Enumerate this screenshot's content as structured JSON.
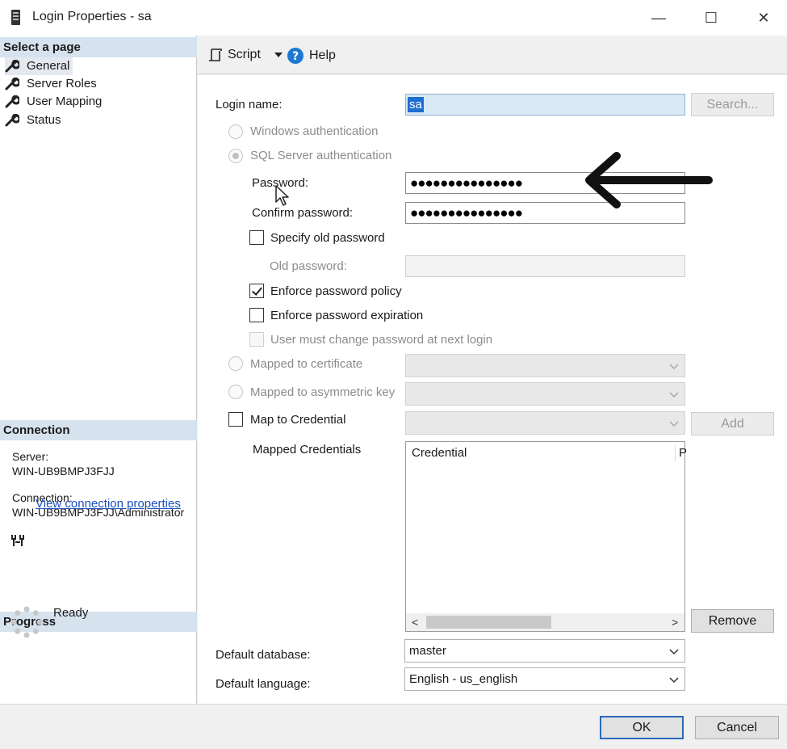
{
  "window": {
    "title": "Login Properties - sa",
    "minimize_glyph": "—",
    "maximize_glyph": "☐",
    "close_glyph": "✕"
  },
  "left_pane": {
    "select_page_header": "Select a page",
    "pages": [
      {
        "label": "General",
        "icon": "wrench-icon",
        "selected": true
      },
      {
        "label": "Server Roles",
        "icon": "wrench-icon",
        "selected": false
      },
      {
        "label": "User Mapping",
        "icon": "wrench-icon",
        "selected": false
      },
      {
        "label": "Status",
        "icon": "wrench-icon",
        "selected": false
      }
    ],
    "connection": {
      "header": "Connection",
      "server_label": "Server:",
      "server_value": "WIN-UB9BMPJ3FJJ",
      "connection_label": "Connection:",
      "connection_value": "WIN-UB9BMPJ3FJJ\\Administrator",
      "view_link": "View connection properties"
    },
    "progress": {
      "header": "Progress",
      "status": "Ready"
    }
  },
  "toolbar": {
    "script_label": "Script",
    "help_label": "Help"
  },
  "general": {
    "login_name_label": "Login name:",
    "login_name_value": "sa",
    "search_button": "Search...",
    "windows_auth_label": "Windows authentication",
    "sql_auth_label": "SQL Server authentication",
    "password_label": "Password:",
    "password_mask": "●●●●●●●●●●●●●●●",
    "confirm_password_label": "Confirm password:",
    "confirm_password_mask": "●●●●●●●●●●●●●●●",
    "specify_old_password_label": "Specify old password",
    "old_password_label": "Old password:",
    "enforce_policy_label": "Enforce password policy",
    "enforce_policy_checked": true,
    "enforce_expiration_label": "Enforce password expiration",
    "must_change_label": "User must change password at next login",
    "mapped_certificate_label": "Mapped to certificate",
    "mapped_asym_key_label": "Mapped to asymmetric key",
    "map_credential_label": "Map to Credential",
    "add_button": "Add",
    "mapped_credentials_label": "Mapped Credentials",
    "credentials_columns": [
      "Credential",
      "P"
    ],
    "remove_button": "Remove",
    "default_database_label": "Default database:",
    "default_database_value": "master",
    "default_language_label": "Default language:",
    "default_language_value": "English - us_english"
  },
  "footer": {
    "ok_button": "OK",
    "cancel_button": "Cancel"
  },
  "colors": {
    "accent": "#1e6fd0",
    "section_header": "#d6e2ee",
    "link": "#1a4fbf"
  }
}
